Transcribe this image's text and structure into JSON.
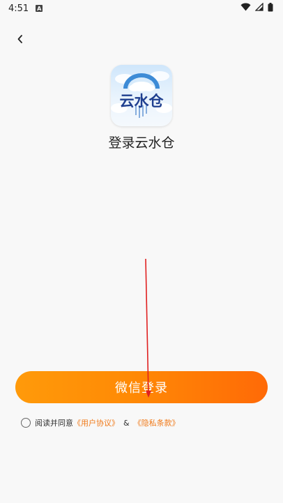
{
  "status_bar": {
    "time": "4:51",
    "notification_letter": "A"
  },
  "header": {
    "back_icon": "chevron-left-icon"
  },
  "app": {
    "logo_text": "云水仓",
    "title": "登录云水仓"
  },
  "login": {
    "wechat_button_label": "微信登录"
  },
  "agreement": {
    "prefix": "阅读并同意",
    "user_agreement": "《用户协议》",
    "ampersand": "&",
    "privacy_policy": "《隐私条款》"
  },
  "colors": {
    "accent_orange": "#ff8a05",
    "link_orange": "#f07a1a",
    "logo_blue": "#1f3f8f",
    "annotation_red": "#e02020"
  }
}
